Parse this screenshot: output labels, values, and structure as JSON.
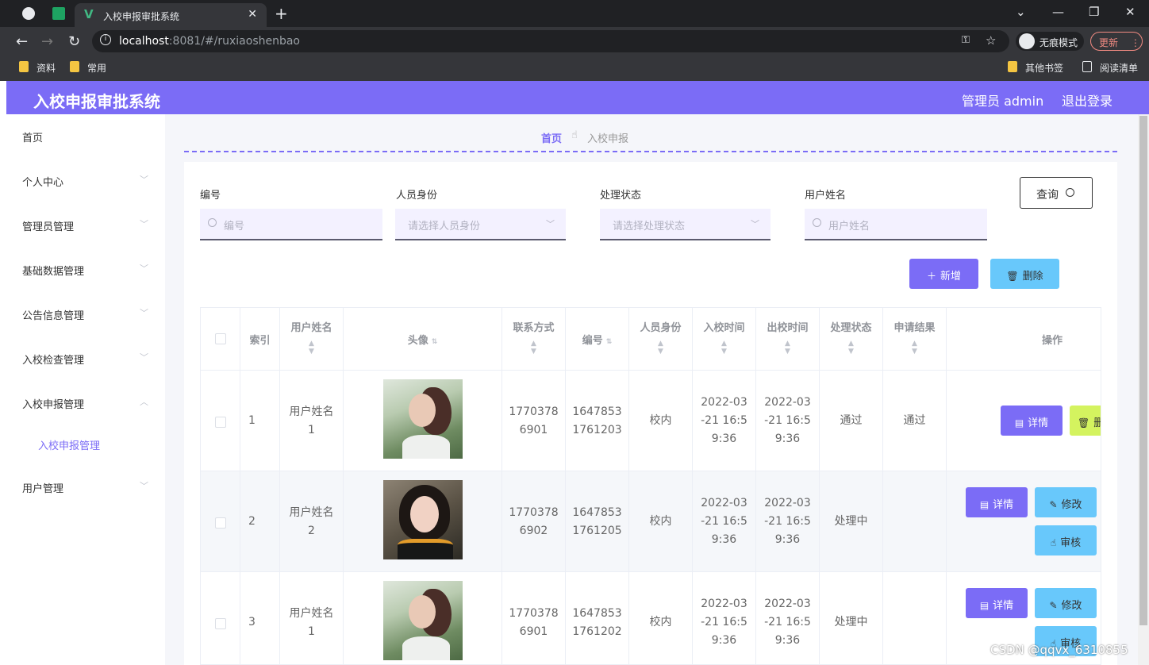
{
  "browser": {
    "tab_title": "入校申报审批系统",
    "url_host": "localhost",
    "url_port": ":8081",
    "url_path": "/#/ruxiaoshenbao",
    "incognito_label": "无痕模式",
    "update_label": "更新",
    "bookmarks": [
      "资料",
      "常用"
    ],
    "bookmarks_right": [
      "其他书签",
      "阅读清单"
    ]
  },
  "header": {
    "brand": "入校申报审批系统",
    "user": "管理员 admin",
    "logout": "退出登录",
    "accent": "#7b6cf6"
  },
  "sidebar": {
    "items": [
      {
        "label": "首页"
      },
      {
        "label": "个人中心"
      },
      {
        "label": "管理员管理"
      },
      {
        "label": "基础数据管理"
      },
      {
        "label": "公告信息管理"
      },
      {
        "label": "入校检查管理"
      },
      {
        "label": "入校申报管理"
      },
      {
        "label": "入校申报管理"
      },
      {
        "label": "用户管理"
      }
    ]
  },
  "breadcrumb": {
    "home": "首页",
    "current": "入校申报"
  },
  "filters": {
    "number_label": "编号",
    "number_placeholder": "编号",
    "identity_label": "人员身份",
    "identity_placeholder": "请选择人员身份",
    "status_label": "处理状态",
    "status_placeholder": "请选择处理状态",
    "username_label": "用户姓名",
    "username_placeholder": "用户姓名",
    "query": "查询"
  },
  "actions": {
    "add": "新增",
    "delete": "删除"
  },
  "table": {
    "headers": [
      "索引",
      "用户姓名",
      "头像",
      "联系方式",
      "编号",
      "人员身份",
      "入校时间",
      "出校时间",
      "处理状态",
      "申请结果",
      "操作"
    ],
    "rows": [
      {
        "index": "1",
        "username": "用户姓名1",
        "phone": "17703786901",
        "number": "16478531761203",
        "identity": "校内",
        "in_time": "2022-03-21 16:59:36",
        "out_time": "2022-03-21 16:59:36",
        "status": "通过",
        "result": "通过"
      },
      {
        "index": "2",
        "username": "用户姓名2",
        "phone": "17703786902",
        "number": "16478531761205",
        "identity": "校内",
        "in_time": "2022-03-21 16:59:36",
        "out_time": "2022-03-21 16:59:36",
        "status": "处理中",
        "result": ""
      },
      {
        "index": "3",
        "username": "用户姓名1",
        "phone": "17703786901",
        "number": "16478531761202",
        "identity": "校内",
        "in_time": "2022-03-21 16:59:36",
        "out_time": "2022-03-21 16:59:36",
        "status": "处理中",
        "result": ""
      }
    ],
    "op_labels": {
      "detail": "详情",
      "edit": "修改",
      "audit": "审核",
      "delete": "删除"
    }
  },
  "watermark": "CSDN @qqvx_6310855"
}
